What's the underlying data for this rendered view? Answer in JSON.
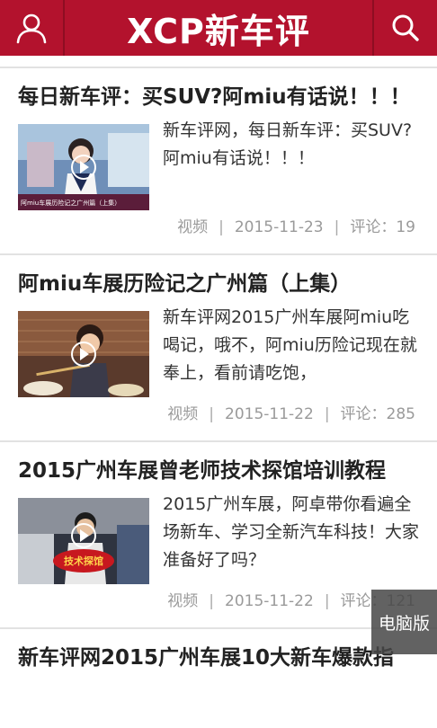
{
  "header": {
    "logo": "XCP新车评",
    "user_icon": "user-icon",
    "search_icon": "search-icon",
    "brand_color": "#b3122d"
  },
  "articles": [
    {
      "title": "每日新车评：买SUV?阿miu有话说！！！",
      "desc": "新车评网，每日新车评：买SUV?阿miu有话说！！！",
      "thumb_caption": "阿miu车展历险记之广州篇（上集）",
      "type": "视频",
      "date": "2015-11-23",
      "comments": "评论：19"
    },
    {
      "title": "阿miu车展历险记之广州篇（上集）",
      "desc": "新车评网2015广州车展阿miu吃喝记，哦不，阿miu历险记现在就奉上，看前请吃饱，",
      "type": "视频",
      "date": "2015-11-22",
      "comments": "评论：285"
    },
    {
      "title": "2015广州车展曾老师技术探馆培训教程",
      "desc": "2015广州车展，阿卓带你看遍全场新车、学习全新汽车科技！大家准备好了吗？",
      "thumb_badge": "技术探馆",
      "type": "视频",
      "date": "2015-11-22",
      "comments": "评论：121"
    },
    {
      "title": "新车评网2015广州车展10大新车爆款指"
    }
  ],
  "pc_button": "电脑版"
}
